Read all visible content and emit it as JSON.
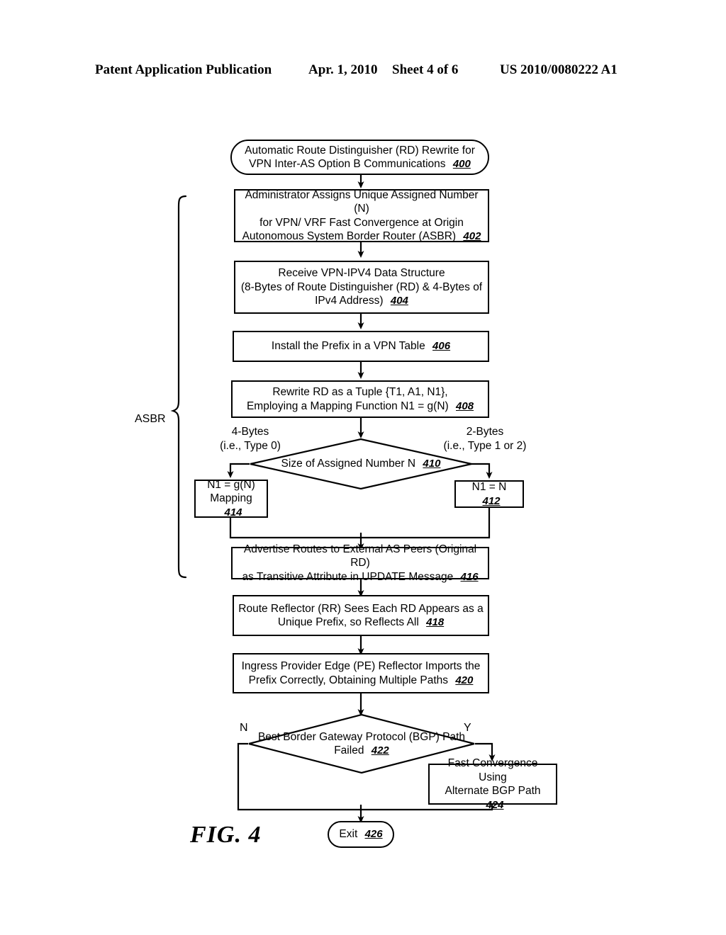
{
  "header": {
    "publication": "Patent Application Publication",
    "date": "Apr. 1, 2010",
    "sheet": "Sheet 4 of 6",
    "number": "US 2010/0080222 A1"
  },
  "figure": {
    "label": "FIG. 4",
    "group_label": "ASBR"
  },
  "flow": {
    "start": {
      "line1": "Automatic Route Distinguisher (RD) Rewrite for",
      "line2": "VPN Inter-AS Option B Communications",
      "ref": "400"
    },
    "step402": {
      "line1": "Administrator Assigns Unique Assigned Number (N)",
      "line2": "for VPN/ VRF Fast Convergence at Origin",
      "line3": "Autonomous System Border Router (ASBR)",
      "ref": "402"
    },
    "step404": {
      "line1": "Receive VPN-IPV4 Data Structure",
      "line2": "(8-Bytes of Route Distinguisher (RD) & 4-Bytes of",
      "line3": "IPv4 Address)",
      "ref": "404"
    },
    "step406": {
      "line1": "Install the Prefix in a VPN Table",
      "ref": "406"
    },
    "step408": {
      "line1": "Rewrite RD as a Tuple {T1, A1, N1},",
      "line2": "Employing a Mapping Function N1 = g(N)",
      "ref": "408"
    },
    "decision410": {
      "line1": "Size of Assigned Number N",
      "ref": "410",
      "branch_left_line1": "4-Bytes",
      "branch_left_line2": "(i.e., Type 0)",
      "branch_right_line1": "2-Bytes",
      "branch_right_line2": "(i.e., Type 1 or 2)"
    },
    "step414": {
      "line1": "N1 = g(N)",
      "line2": "Mapping",
      "ref": "414"
    },
    "step412": {
      "line1": "N1 = N",
      "ref": "412"
    },
    "step416": {
      "line1": "Advertise Routes to External AS Peers (Original RD)",
      "line2": "as Transitive Attribute in UPDATE Message",
      "ref": "416"
    },
    "step418": {
      "line1": "Route Reflector (RR) Sees Each RD Appears as a",
      "line2": "Unique Prefix, so Reflects All",
      "ref": "418"
    },
    "step420": {
      "line1": "Ingress Provider Edge (PE) Reflector Imports the",
      "line2": "Prefix Correctly, Obtaining Multiple Paths",
      "ref": "420"
    },
    "decision422": {
      "line1": "Best",
      "line2": "Border Gateway Protocol (BGP) Path",
      "line3": "Failed",
      "ref": "422",
      "branch_no": "N",
      "branch_yes": "Y"
    },
    "step424": {
      "line1": "Fast Convergence Using",
      "line2": "Alternate BGP Path",
      "ref": "424"
    },
    "exit": {
      "line1": "Exit",
      "ref": "426"
    }
  },
  "colors": {
    "ink": "#000000",
    "paper": "#ffffff"
  }
}
